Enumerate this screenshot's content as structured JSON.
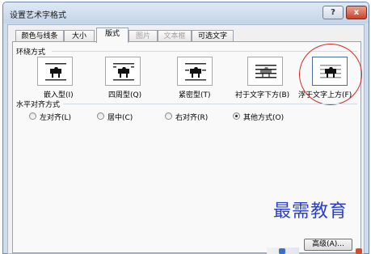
{
  "window": {
    "title": "设置艺术字格式",
    "help_label": "?",
    "close_label": "x"
  },
  "tabs": [
    {
      "label": "颜色与线条",
      "state": "normal"
    },
    {
      "label": "大小",
      "state": "normal"
    },
    {
      "label": "版式",
      "state": "active"
    },
    {
      "label": "图片",
      "state": "disabled"
    },
    {
      "label": "文本框",
      "state": "disabled"
    },
    {
      "label": "可选文字",
      "state": "normal"
    }
  ],
  "wrap_section": {
    "heading": "环绕方式",
    "options": [
      {
        "label": "嵌入型(I)",
        "icon": "inline-wrap-icon"
      },
      {
        "label": "四周型(Q)",
        "icon": "square-wrap-icon"
      },
      {
        "label": "紧密型(T)",
        "icon": "tight-wrap-icon"
      },
      {
        "label": "衬于文字下方(B)",
        "icon": "behind-text-icon"
      },
      {
        "label": "浮于文字上方(F)",
        "icon": "in-front-of-text-icon",
        "selected": true
      }
    ]
  },
  "align_section": {
    "heading": "水平对齐方式",
    "options": [
      {
        "label": "左对齐(L)",
        "checked": false
      },
      {
        "label": "居中(C)",
        "checked": false
      },
      {
        "label": "右对齐(R)",
        "checked": false
      },
      {
        "label": "其他方式(O)",
        "checked": true
      }
    ]
  },
  "advanced_button": "高级(A)...",
  "watermark": "最需教育",
  "colors": {
    "highlight": "#d62b2b",
    "watermark": "#2a3fc9",
    "title_bar": "#c3d4e8"
  }
}
